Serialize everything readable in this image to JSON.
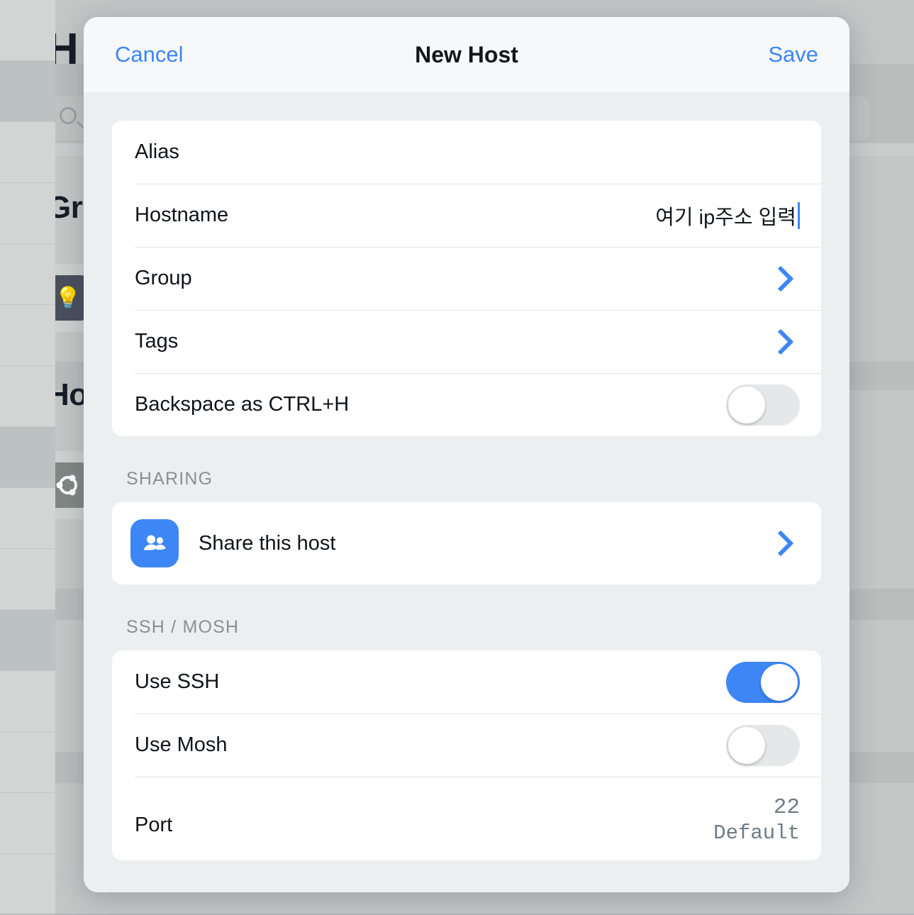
{
  "background": {
    "title_top": "H",
    "groups_title": "Gr",
    "hosts_title": "Ho",
    "search_icon": "search-icon",
    "tile_lightbulb_glyph": "💡",
    "tile_ubuntu_glyph": "◌"
  },
  "modal": {
    "header": {
      "cancel_label": "Cancel",
      "title": "New Host",
      "save_label": "Save"
    },
    "general": {
      "rows": [
        {
          "label": "Alias",
          "value": "",
          "type": "text"
        },
        {
          "label": "Hostname",
          "value": "여기 ip주소 입력",
          "type": "text-focused"
        },
        {
          "label": "Group",
          "type": "disclosure",
          "icon": "chevron-right-icon"
        },
        {
          "label": "Tags",
          "type": "disclosure",
          "icon": "chevron-right-icon"
        },
        {
          "label": "Backspace as CTRL+H",
          "type": "toggle",
          "on": false
        }
      ]
    },
    "sharing": {
      "header": "SHARING",
      "row": {
        "label": "Share this host",
        "icon": "people-icon",
        "icon_color": "#3d86f5",
        "disclosure_icon": "chevron-right-icon"
      }
    },
    "ssh_mosh": {
      "header": "SSH / MOSH",
      "rows": [
        {
          "label": "Use SSH",
          "type": "toggle",
          "on": true
        },
        {
          "label": "Use Mosh",
          "type": "toggle",
          "on": false
        },
        {
          "label": "Port",
          "type": "value-stack",
          "value": "22",
          "subvalue": "Default"
        }
      ]
    }
  },
  "colors": {
    "accent": "#3d86f5",
    "toggle_off": "#e6e7e8",
    "modal_bg": "#eceff0",
    "header_bg": "#f7f8f9",
    "section_header_text": "#8a9097"
  }
}
